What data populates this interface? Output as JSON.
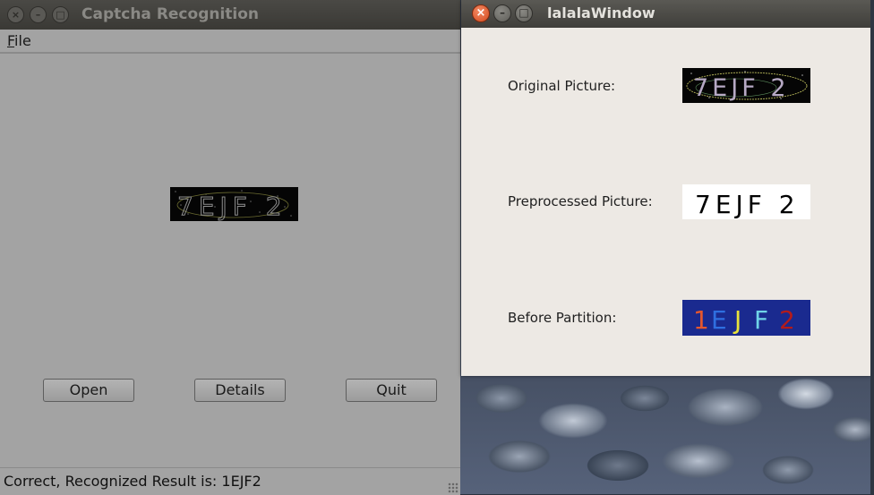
{
  "main_window": {
    "title": "Captcha Recognition",
    "menu": {
      "file_label_underlined": "F",
      "file_label_rest": "ile"
    },
    "captcha_text": "7EJF2",
    "buttons": {
      "open": "Open",
      "details": "Details",
      "quit": "Quit"
    },
    "status": "Correct, Recognized Result is: 1EJF2"
  },
  "popup_window": {
    "title": "lalalaWindow",
    "rows": [
      {
        "label": "Original Picture:"
      },
      {
        "label": "Preprocessed Picture:"
      },
      {
        "label": "Before Partition:"
      }
    ]
  },
  "icons": {
    "close": "close-icon",
    "minimize": "minimize-icon",
    "maximize": "maximize-icon"
  },
  "colors": {
    "popup_close": "#d4491d",
    "partition_bg": "#1a2a8f",
    "partition_chars": [
      "#e4572e",
      "#2f6fe0",
      "#e9e33a",
      "#6fd3e8",
      "#b31b1b"
    ]
  }
}
